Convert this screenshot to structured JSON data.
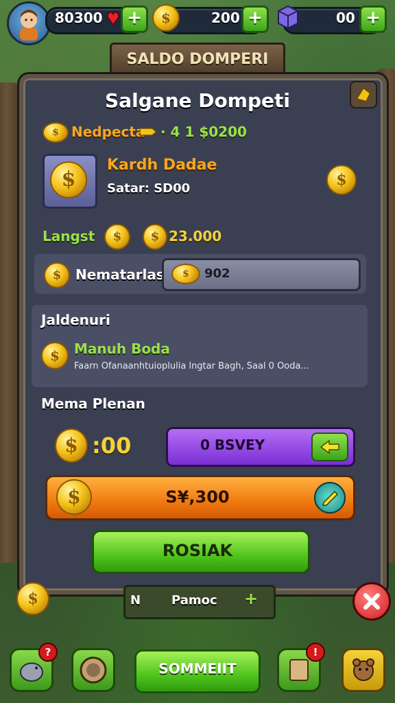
{
  "hud": {
    "gems": "80300",
    "coins": "200",
    "items": "00",
    "plus": "+"
  },
  "title_plaque": "SALDO DOMPERI",
  "panel": {
    "heading": "Salgane Dompeti",
    "row1_label": "Nedpecta",
    "row1_value": "· 4 1 $0200",
    "card_title": "Kardh Dadae",
    "card_sub": "Satar: SD00",
    "langst_label": "Langst",
    "langst_value": "23.000",
    "nemat_label": "Nematarlas",
    "nemat_value": "902",
    "section2_title": "Jaldenuri",
    "section2_item_title": "Manuh Boda",
    "section2_item_desc": "Faarn Ofanaanhtuioplulia lngtar Bagh, Saal 0 Ooda...",
    "section3_title": "Mema Plenan",
    "amount": ":00",
    "purple_btn": "0 BSVEY",
    "orange_btn": "S¥,300",
    "green_btn": "ROSIAK"
  },
  "behind_bar": {
    "left": "N",
    "center": "Pamoc",
    "plus": "+"
  },
  "bottom_nav": {
    "center_btn": "SOMMEIIT",
    "badge_1": "?",
    "badge_2": "!"
  },
  "icons": {
    "avatar": "avatar-boy",
    "gem": "heart-gem-icon",
    "coin": "coin-icon",
    "box": "gift-box-icon",
    "close": "close-icon",
    "corner": "wing-icon"
  },
  "colors": {
    "panel": "#3a3f52",
    "accent_green": "#4fc41c",
    "accent_orange": "#f07a10",
    "accent_purple": "#7a2fd4"
  }
}
